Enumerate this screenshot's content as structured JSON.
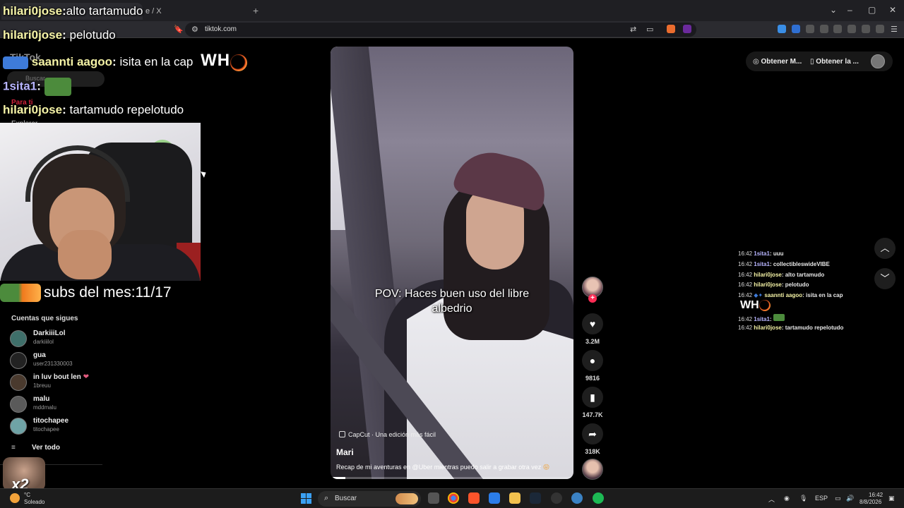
{
  "browser": {
    "url": "tiktok.com",
    "tab_extra": "e / X",
    "new_tab_icon": "plus-icon"
  },
  "tiktok": {
    "logo": "TikTok",
    "search_placeholder": "Buscar",
    "nav_for_you": "Para ti",
    "nav_explore": "Explorar",
    "following_header": "Cuentas que sigues",
    "following": [
      {
        "name": "DarkiiiLol",
        "user": "darkiiilol"
      },
      {
        "name": "gua",
        "user": "user231330003"
      },
      {
        "name": "in luv bout len",
        "user": "1breuu"
      },
      {
        "name": "malu",
        "user": "mddmalu"
      },
      {
        "name": "titochapee",
        "user": "titochapee"
      }
    ],
    "see_all": "Ver todo",
    "header_btn_1": "Obtener M...",
    "header_btn_2": "Obtener la ..."
  },
  "overlay": {
    "chat": [
      {
        "user": "hilari0jose",
        "msg": "alto tartamudo"
      },
      {
        "user": "hilari0jose",
        "msg": "pelotudo"
      },
      {
        "user": "saannti aagoo",
        "msg": "isita en la cap",
        "extra": "WH"
      },
      {
        "user": "1sita1",
        "msg": ""
      },
      {
        "user": "hilari0jose",
        "msg": "tartamudo repelotudo"
      }
    ],
    "subs": "subs del mes:11/17",
    "multiplier": "x2"
  },
  "video": {
    "caption": "POV: Haces buen uso del libre albedrio",
    "capcut": "CapCut · Una edición más fácil",
    "author": "Mari",
    "description": "Recap de mi aventuras en @Uber mientras puedo salir a grabar otra vez",
    "progress": 0.06
  },
  "actions": {
    "likes": "3.2M",
    "comments": "9816",
    "saves": "147.7K",
    "shares": "318K"
  },
  "side_chat": [
    {
      "time": "16:42",
      "user": "1sita1",
      "msg": "uuu"
    },
    {
      "time": "16:42",
      "user": "1sita1",
      "msg": "collectibleswideVIBE"
    },
    {
      "time": "16:42",
      "user": "hilari0jose",
      "msg": "alto tartamudo"
    },
    {
      "time": "16:42",
      "user": "hilari0jose",
      "msg": "pelotudo"
    },
    {
      "time": "16:42",
      "user": "saannti aagoo",
      "msg": "isita en la cap"
    },
    {
      "time": "16:42",
      "user": "1sita1",
      "msg": ""
    },
    {
      "time": "16:42",
      "user": "hilari0jose",
      "msg": "tartamudo repelotudo"
    }
  ],
  "side_chat_who": "WH",
  "taskbar": {
    "weather_temp": "°C",
    "weather_cond": "Soleado",
    "search": "Buscar",
    "lang": "ESP",
    "time": "16:42",
    "date": "8/8/2026"
  },
  "colors": {
    "accent_tiktok": "#fe2c55",
    "chat_user": "#f5f3a6",
    "chat_user_alt": "#b8b5ff"
  }
}
